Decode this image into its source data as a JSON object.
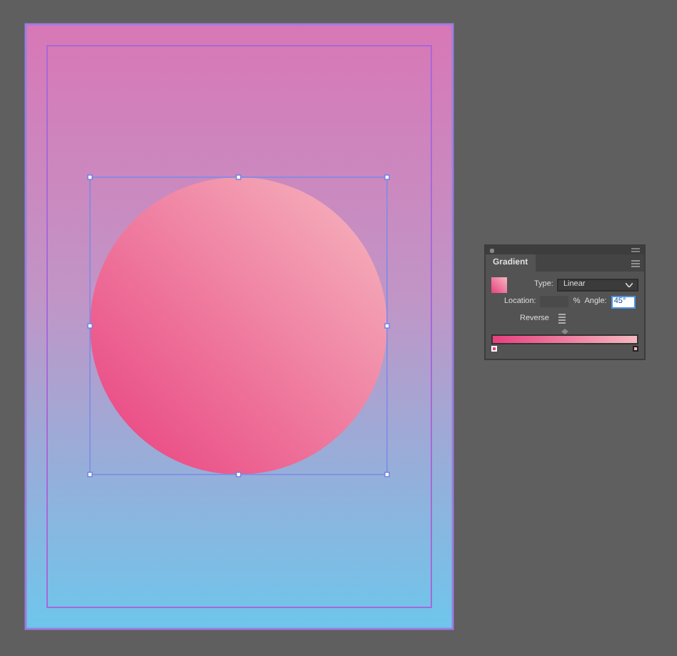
{
  "panel": {
    "title": "Gradient",
    "type_label": "Type:",
    "type_value": "Linear",
    "location_label": "Location:",
    "location_unit": "%",
    "angle_label": "Angle:",
    "angle_value": "45°",
    "reverse_label": "Reverse"
  },
  "ramp": {
    "stops": [
      {
        "color": "#e8407f",
        "selected": true
      },
      {
        "color": "#f6b8c0",
        "selected": false
      }
    ]
  }
}
